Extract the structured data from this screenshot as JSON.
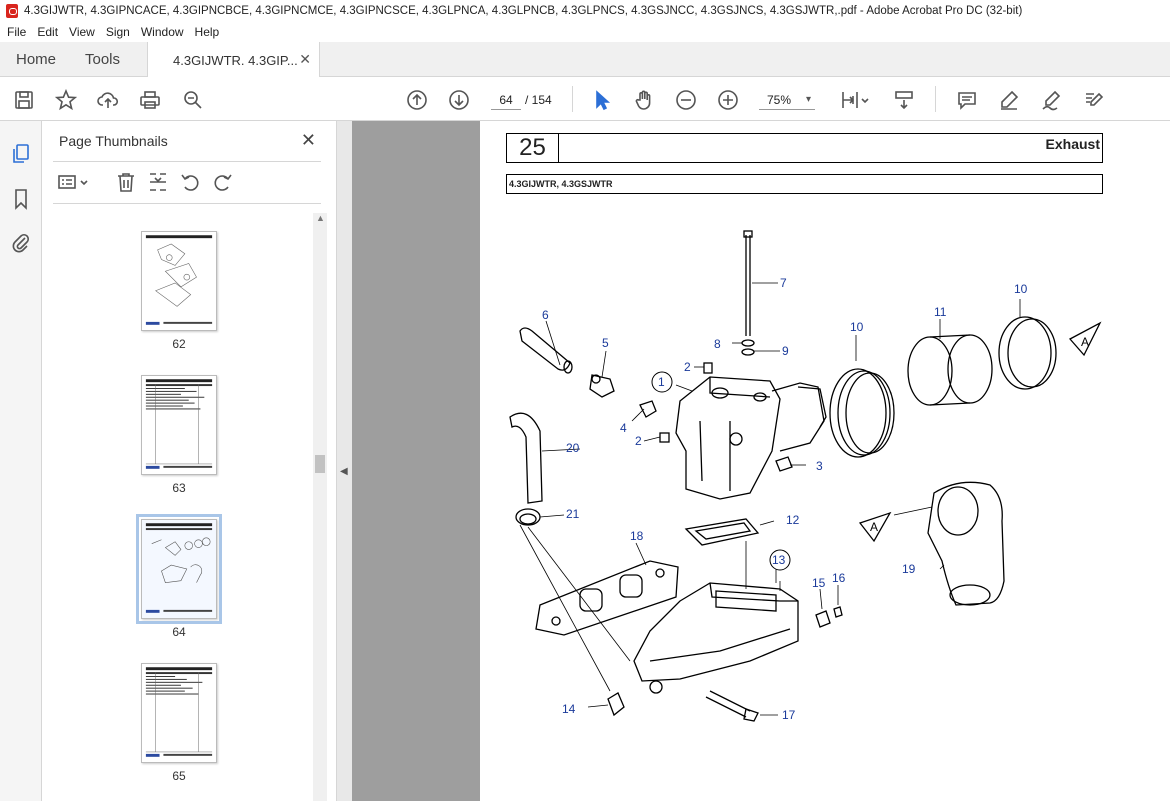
{
  "window": {
    "title": "4.3GIJWTR, 4.3GIPNCACE, 4.3GIPNCBCE, 4.3GIPNCMCE, 4.3GIPNCSCE, 4.3GLPNCA, 4.3GLPNCB, 4.3GLPNCS, 4.3GSJNCC, 4.3GSJNCS, 4.3GSJWTR,.pdf - Adobe Acrobat Pro DC (32-bit)"
  },
  "menu": [
    "File",
    "Edit",
    "View",
    "Sign",
    "Window",
    "Help"
  ],
  "tabs": {
    "home": "Home",
    "tools": "Tools",
    "document": "4.3GIJWTR. 4.3GIP..."
  },
  "toolbar": {
    "current_page": "64",
    "page_count": "/ 154",
    "zoom": "75%"
  },
  "panel": {
    "title": "Page Thumbnails"
  },
  "thumbnails": [
    {
      "label": "62",
      "selected": false
    },
    {
      "label": "63",
      "selected": false
    },
    {
      "label": "64",
      "selected": true
    },
    {
      "label": "65",
      "selected": false
    }
  ],
  "document_page": {
    "section_number": "25",
    "section_title": "Exhaust",
    "models": "4.3GIJWTR, 4.3GSJWTR",
    "callouts": [
      "1",
      "2",
      "2",
      "3",
      "4",
      "5",
      "6",
      "7",
      "8",
      "9",
      "10",
      "10",
      "11",
      "12",
      "13",
      "14",
      "15",
      "16",
      "17",
      "18",
      "19",
      "20",
      "21",
      "A",
      "A"
    ]
  },
  "colors": {
    "callout": "#1a3a9a",
    "selected_thumb": "#a9c6e8",
    "viewer_bg": "#9e9e9e"
  }
}
